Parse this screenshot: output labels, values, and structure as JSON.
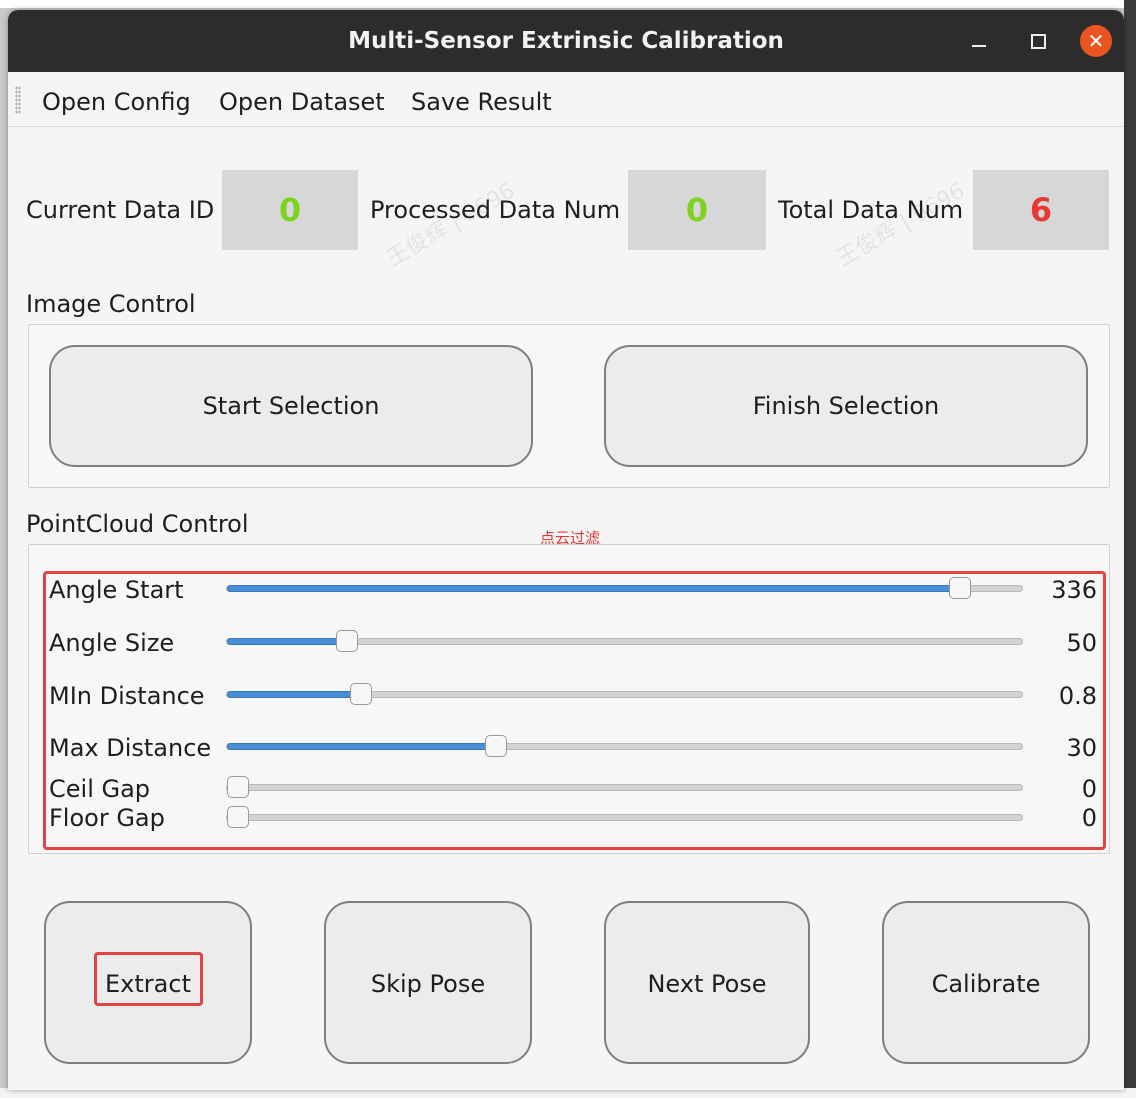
{
  "window": {
    "title": "Multi-Sensor Extrinsic Calibration",
    "close_glyph": "✕"
  },
  "menu": {
    "items": [
      "Open Config",
      "Open Dataset",
      "Save Result"
    ]
  },
  "stats": {
    "current_label": "Current Data ID",
    "current_value": "0",
    "processed_label": "Processed Data Num",
    "processed_value": "0",
    "total_label": "Total Data Num",
    "total_value": "6",
    "colors": {
      "current": "#7ed321",
      "processed": "#7ed321",
      "total": "#e53935"
    }
  },
  "image_control": {
    "label": "Image Control",
    "start_button": "Start Selection",
    "finish_button": "Finish Selection"
  },
  "pointcloud_control": {
    "label": "PointCloud Control",
    "annotation": "点云过滤",
    "sliders": [
      {
        "label": "Angle Start",
        "value": "336",
        "fraction": 0.92
      },
      {
        "label": "Angle Size",
        "value": "50",
        "fraction": 0.15
      },
      {
        "label": "MIn Distance",
        "value": "0.8",
        "fraction": 0.168
      },
      {
        "label": "Max Distance",
        "value": "30",
        "fraction": 0.338
      },
      {
        "label": "Ceil Gap",
        "value": "0",
        "fraction": 0.0
      },
      {
        "label": "Floor Gap",
        "value": "0",
        "fraction": 0.0
      }
    ]
  },
  "actions": {
    "extract": "Extract",
    "skip": "Skip Pose",
    "next": "Next Pose",
    "calibrate": "Calibrate"
  },
  "colors": {
    "slider_fill": "#4a8ed8",
    "annotation_red": "#e04444",
    "close_button": "#e95420"
  },
  "icons": {
    "minimize": "minimize-icon",
    "maximize": "maximize-icon",
    "close": "close-icon"
  }
}
